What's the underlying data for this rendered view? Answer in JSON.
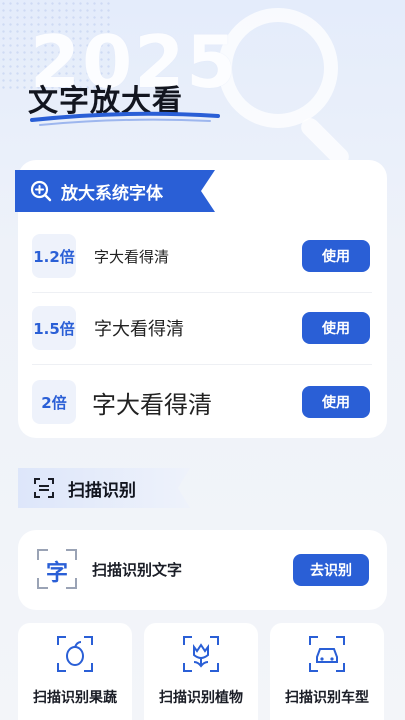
{
  "header": {
    "year": "2025",
    "title": "文字放大看"
  },
  "enlarge_section": {
    "title": "放大系统字体",
    "items": [
      {
        "badge": "1.2倍",
        "sample": "字大看得清",
        "button": "使用"
      },
      {
        "badge": "1.5倍",
        "sample": "字大看得清",
        "button": "使用"
      },
      {
        "badge": "2倍",
        "sample": "字大看得清",
        "button": "使用"
      }
    ]
  },
  "scan_section": {
    "title": "扫描识别",
    "text_scan": {
      "icon_char": "字",
      "label": "扫描识别文字",
      "button": "去识别"
    },
    "tiles": [
      {
        "icon": "fruit-scan-icon",
        "label": "扫描识别果蔬"
      },
      {
        "icon": "plant-scan-icon",
        "label": "扫描识别植物"
      },
      {
        "icon": "car-scan-icon",
        "label": "扫描识别车型"
      }
    ]
  },
  "colors": {
    "accent": "#2a5fd6",
    "background": "#eef1f7",
    "card": "#ffffff"
  }
}
